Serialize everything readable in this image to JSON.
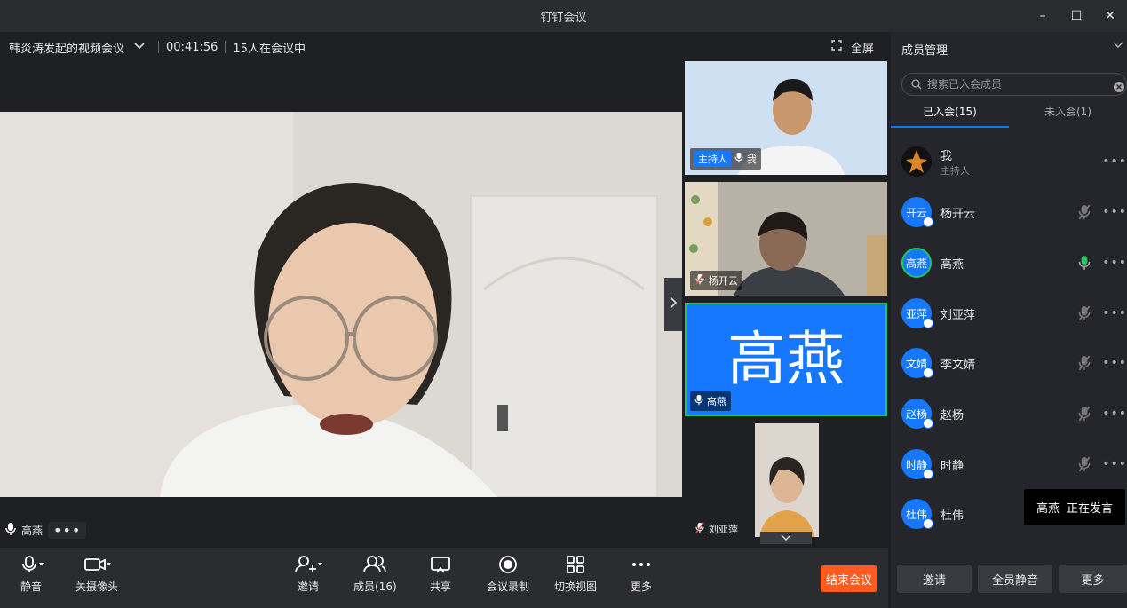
{
  "window": {
    "title": "钉钉会议",
    "minimize": "–",
    "maximize": "☐",
    "close": "✕"
  },
  "meeting": {
    "title": "韩炎涛发起的视频会议",
    "duration": "00:41:56",
    "participants_status": "15人在会议中",
    "fullscreen_label": "全屏"
  },
  "main_video": {
    "speaker": "高燕"
  },
  "thumbnails": [
    {
      "host_tag": "主持人",
      "name": "我"
    },
    {
      "name": "杨开云"
    },
    {
      "name": "高燕",
      "big_text": "高燕"
    },
    {
      "name": "刘亚萍"
    }
  ],
  "toolbar": {
    "mute": "静音",
    "camera": "关摄像头",
    "invite": "邀请",
    "members": "成员(16)",
    "share": "共享",
    "record": "会议录制",
    "switch_view": "切换视图",
    "more": "更多",
    "end": "结束会议"
  },
  "panel": {
    "title": "成员管理",
    "search_placeholder": "搜索已入会成员",
    "tab_joined": "已入会(15)",
    "tab_not_joined": "未入会(1)",
    "members": [
      {
        "avatar": "",
        "name": "我",
        "role": "主持人"
      },
      {
        "avatar": "开云",
        "name": "杨开云"
      },
      {
        "avatar": "高燕",
        "name": "高燕"
      },
      {
        "avatar": "亚萍",
        "name": "刘亚萍"
      },
      {
        "avatar": "文婧",
        "name": "李文婧"
      },
      {
        "avatar": "赵杨",
        "name": "赵杨"
      },
      {
        "avatar": "时静",
        "name": "时静"
      },
      {
        "avatar": "杜伟",
        "name": "杜伟"
      }
    ],
    "tooltip_name": "高燕",
    "tooltip_status": "正在发言",
    "btn_invite": "邀请",
    "btn_mute_all": "全员静音",
    "btn_more": "更多"
  },
  "colors": {
    "accent": "#1677ff",
    "end_button": "#ff5a1f",
    "speaking_green": "#22c55e"
  }
}
